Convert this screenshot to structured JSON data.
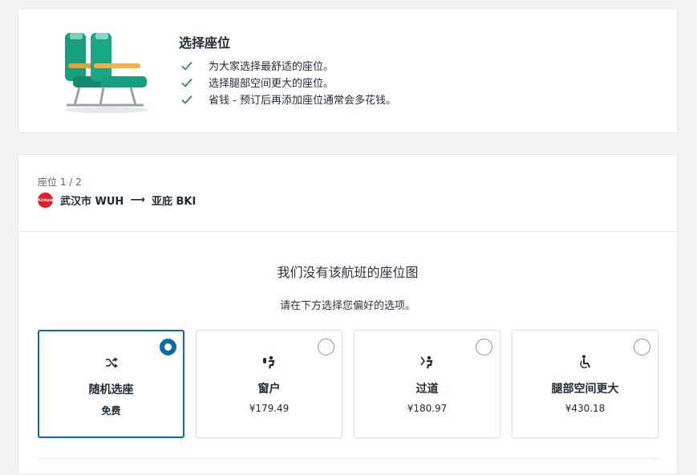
{
  "promo": {
    "title": "选择座位",
    "benefits": [
      "为大家选择最舒适的座位。",
      "选择腿部空间更大的座位。",
      "省钱 - 预订后再添加座位通常会多花钱。"
    ],
    "check_color": "#2e8b57",
    "seat_color": "#1aa884"
  },
  "segment": {
    "label": "座位 1 / 2",
    "airline_logo_text": "AirAsia",
    "origin": "武汉市 WUH",
    "arrow": "⟶",
    "destination": "亚庇 BKI"
  },
  "no_seatmap": {
    "title": "我们没有该航班的座位图",
    "subtitle": "请在下方选择您偏好的选项。"
  },
  "options": [
    {
      "name": "随机选座",
      "price": "免费",
      "icon": "shuffle-icon",
      "selected": true
    },
    {
      "name": "窗户",
      "price": "¥179.49",
      "icon": "window-seat-icon",
      "selected": false
    },
    {
      "name": "过道",
      "price": "¥180.97",
      "icon": "aisle-seat-icon",
      "selected": false
    },
    {
      "name": "腿部空间更大",
      "price": "¥430.18",
      "icon": "legroom-icon",
      "selected": false
    }
  ],
  "accent_color": "#0b6aa8"
}
